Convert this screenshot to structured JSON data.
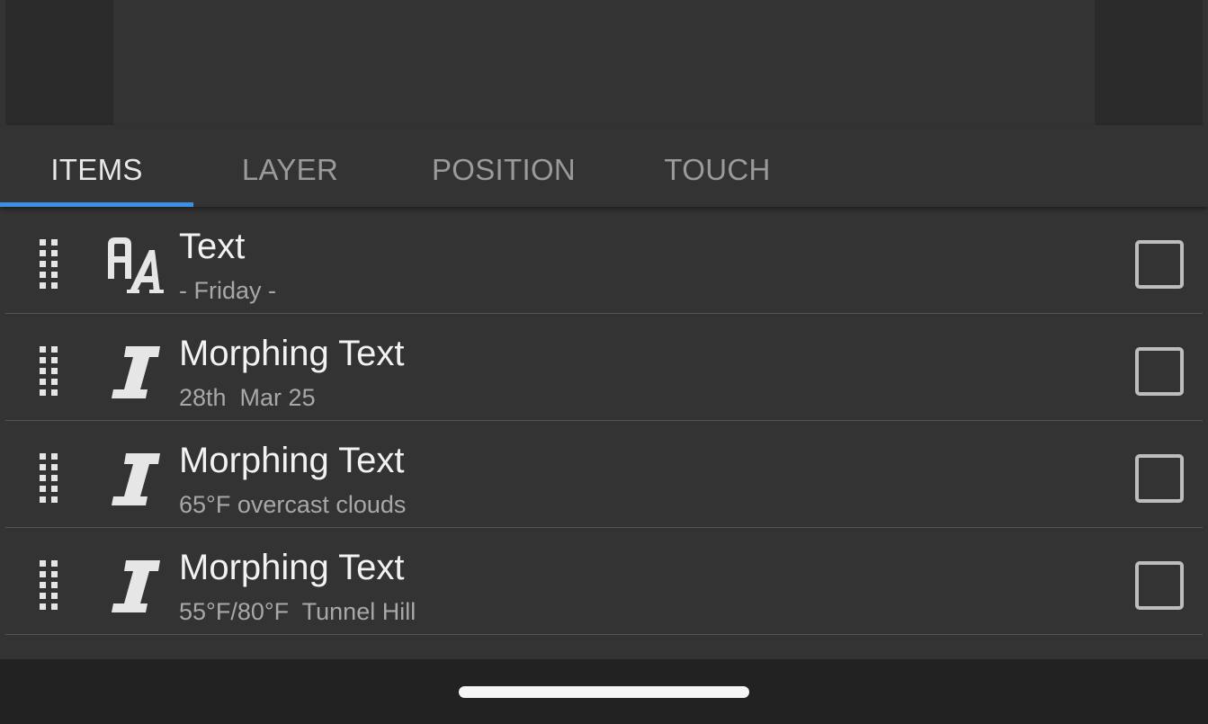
{
  "tabs": [
    {
      "label": "ITEMS",
      "active": true
    },
    {
      "label": "LAYER",
      "active": false
    },
    {
      "label": "POSITION",
      "active": false
    },
    {
      "label": "TOUCH",
      "active": false
    }
  ],
  "items": [
    {
      "title": "Text",
      "subtitle": "- Friday -",
      "icon": "text-aa-icon",
      "checked": false
    },
    {
      "title": "Morphing Text",
      "subtitle": "28th  Mar 25",
      "icon": "morphing-text-icon",
      "checked": false
    },
    {
      "title": "Morphing Text",
      "subtitle": "65°F overcast clouds",
      "icon": "morphing-text-icon",
      "checked": false
    },
    {
      "title": "Morphing Text",
      "subtitle": "55°F/80°F  Tunnel Hill",
      "icon": "morphing-text-icon",
      "checked": false
    }
  ],
  "colors": {
    "background": "#333333",
    "accent": "#3d8fe6",
    "navbar": "#222222"
  }
}
